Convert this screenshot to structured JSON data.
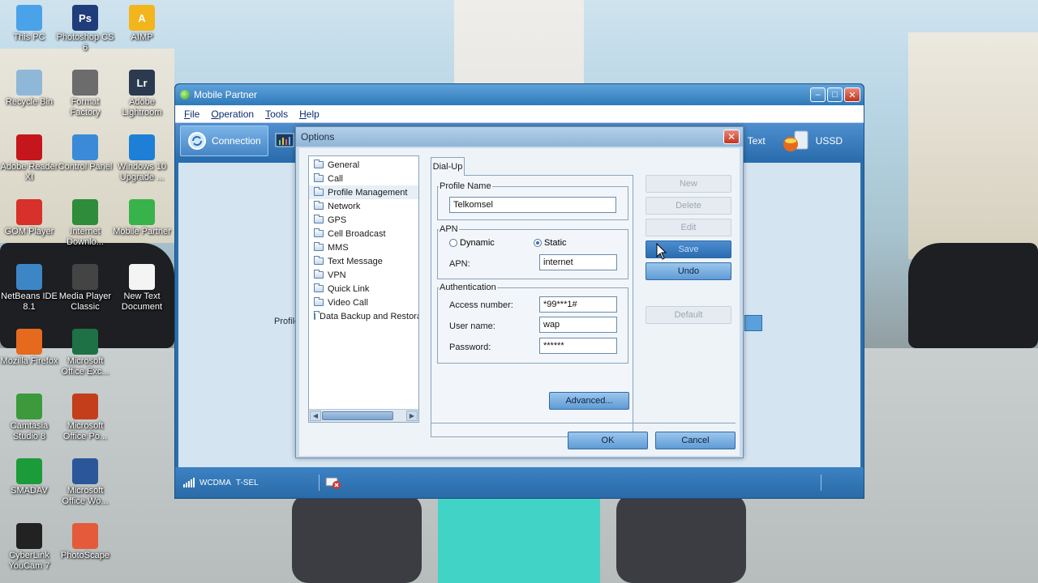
{
  "desktop": {
    "icons": [
      {
        "label": "This PC",
        "icon": "this-pc-icon",
        "color": "#4aa3e8"
      },
      {
        "label": "Photoshop CS 6",
        "icon": "photoshop-icon",
        "color": "#1f3d7a",
        "glyph": "Ps"
      },
      {
        "label": "AIMP",
        "icon": "aimp-icon",
        "color": "#f2b51b",
        "glyph": "A"
      },
      {
        "label": "Recycle Bin",
        "icon": "recycle-bin-icon",
        "color": "#8fb8d8"
      },
      {
        "label": "Format Factory",
        "icon": "format-factory-icon",
        "color": "#6c6c6c"
      },
      {
        "label": "Adobe Lightroom",
        "icon": "lightroom-icon",
        "color": "#2b3a4e",
        "glyph": "Lr"
      },
      {
        "label": "Adobe Reader XI",
        "icon": "adobe-reader-icon",
        "color": "#c4161c"
      },
      {
        "label": "Control Panel",
        "icon": "control-panel-icon",
        "color": "#3a8ad8"
      },
      {
        "label": "Windows 10 Upgrade ...",
        "icon": "windows-upgrade-icon",
        "color": "#1d7fd6"
      },
      {
        "label": "GOM Player",
        "icon": "gom-player-icon",
        "color": "#d8302a"
      },
      {
        "label": "Internet Downlo...",
        "icon": "idm-icon",
        "color": "#2e8c3a"
      },
      {
        "label": "Mobile Partner",
        "icon": "mobile-partner-icon",
        "color": "#38b24a"
      },
      {
        "label": "NetBeans IDE 8.1",
        "icon": "netbeans-icon",
        "color": "#3d86c6"
      },
      {
        "label": "Media Player Classic",
        "icon": "media-player-icon",
        "color": "#444"
      },
      {
        "label": "New Text Document",
        "icon": "text-document-icon",
        "color": "#f4f4f4"
      },
      {
        "label": "Mozilla Firefox",
        "icon": "firefox-icon",
        "color": "#e66a1e"
      },
      {
        "label": "Microsoft Office Exc...",
        "icon": "excel-icon",
        "color": "#1e7145"
      },
      {
        "label": "Camtasia Studio 8",
        "icon": "camtasia-icon",
        "color": "#3c9a3c"
      },
      {
        "label": "Microsoft Office Po...",
        "icon": "powerpoint-icon",
        "color": "#c43e1c"
      },
      {
        "label": "SMADAV",
        "icon": "smadav-icon",
        "color": "#1b9b3a"
      },
      {
        "label": "Microsoft Office Wo...",
        "icon": "word-icon",
        "color": "#2b579a"
      },
      {
        "label": "CyberLink YouCam 7",
        "icon": "youcam-icon",
        "color": "#222"
      },
      {
        "label": "PhotoScape",
        "icon": "photoscape-icon",
        "color": "#e45a3b"
      }
    ]
  },
  "main_window": {
    "title": "Mobile Partner",
    "menu": [
      "File",
      "Operation",
      "Tools",
      "Help"
    ],
    "toolbar": {
      "connection": "Connection",
      "text": "Text",
      "ussd": "USSD"
    },
    "profile_label": "Profile",
    "status": {
      "network": "WCDMA",
      "operator": "T-SEL"
    }
  },
  "dialog": {
    "title": "Options",
    "tree": [
      "General",
      "Call",
      "Profile Management",
      "Network",
      "GPS",
      "Cell Broadcast",
      "MMS",
      "Text Message",
      "VPN",
      "Quick Link",
      "Video Call",
      "Data Backup and Restora"
    ],
    "selected_item": "Profile Management",
    "tab": "Dial-Up",
    "profile_name_group": "Profile Name",
    "profile_name_value": "Telkomsel",
    "apn_group": "APN",
    "apn_dynamic": "Dynamic",
    "apn_static": "Static",
    "apn_label": "APN:",
    "apn_value": "internet",
    "auth_group": "Authentication",
    "access_number_label": "Access number:",
    "access_number_value": "*99***1#",
    "user_name_label": "User name:",
    "user_name_value": "wap",
    "password_label": "Password:",
    "password_value": "******",
    "advanced_button": "Advanced...",
    "buttons": {
      "new": "New",
      "delete": "Delete",
      "edit": "Edit",
      "save": "Save",
      "undo": "Undo",
      "default": "Default"
    },
    "ok": "OK",
    "cancel": "Cancel"
  }
}
